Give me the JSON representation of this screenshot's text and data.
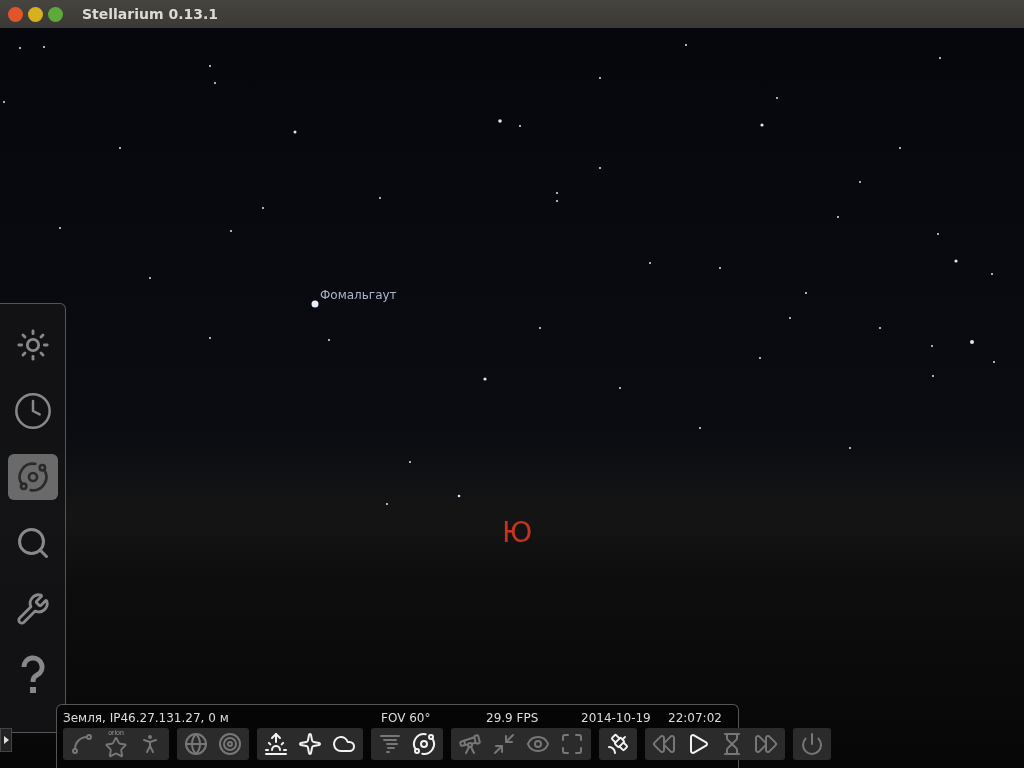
{
  "window": {
    "title": "Stellarium 0.13.1"
  },
  "sky": {
    "star_label": "Фомальгаут",
    "cardinal": "Ю"
  },
  "sidebar": {
    "items": [
      {
        "kind": "location",
        "selected": false
      },
      {
        "kind": "time",
        "selected": false
      },
      {
        "kind": "sky",
        "selected": true
      },
      {
        "kind": "search",
        "selected": false
      },
      {
        "kind": "settings",
        "selected": false
      },
      {
        "kind": "help",
        "selected": false
      }
    ]
  },
  "status_bar": {
    "location": "Земля, IP46.27.131.27, 0 м",
    "fov": "FOV 60°",
    "fps": "29.9 FPS",
    "date": "2014-10-19",
    "time": "22:07:02"
  },
  "toolbar": {
    "groups": [
      [
        {
          "kind": "constellation-lines",
          "on": false
        },
        {
          "kind": "constellation-labels",
          "on": false,
          "label": "orion"
        },
        {
          "kind": "constellation-art",
          "on": false
        }
      ],
      [
        {
          "kind": "equatorial-grid",
          "on": false
        },
        {
          "kind": "azimuthal-grid",
          "on": false
        }
      ],
      [
        {
          "kind": "ground",
          "on": true
        },
        {
          "kind": "cardinal",
          "on": true
        },
        {
          "kind": "atmosphere",
          "on": true
        }
      ],
      [
        {
          "kind": "nebulae",
          "on": false
        },
        {
          "kind": "planets",
          "on": true
        }
      ],
      [
        {
          "kind": "telescope",
          "on": false
        },
        {
          "kind": "center",
          "on": false
        },
        {
          "kind": "night",
          "on": false
        },
        {
          "kind": "fullscreen",
          "on": false
        }
      ],
      [
        {
          "kind": "satellite",
          "on": true
        }
      ],
      [
        {
          "kind": "rewind",
          "on": false
        },
        {
          "kind": "play",
          "on": true
        },
        {
          "kind": "now",
          "on": false
        },
        {
          "kind": "forward",
          "on": false
        }
      ],
      [
        {
          "kind": "quit",
          "on": false
        }
      ]
    ]
  }
}
